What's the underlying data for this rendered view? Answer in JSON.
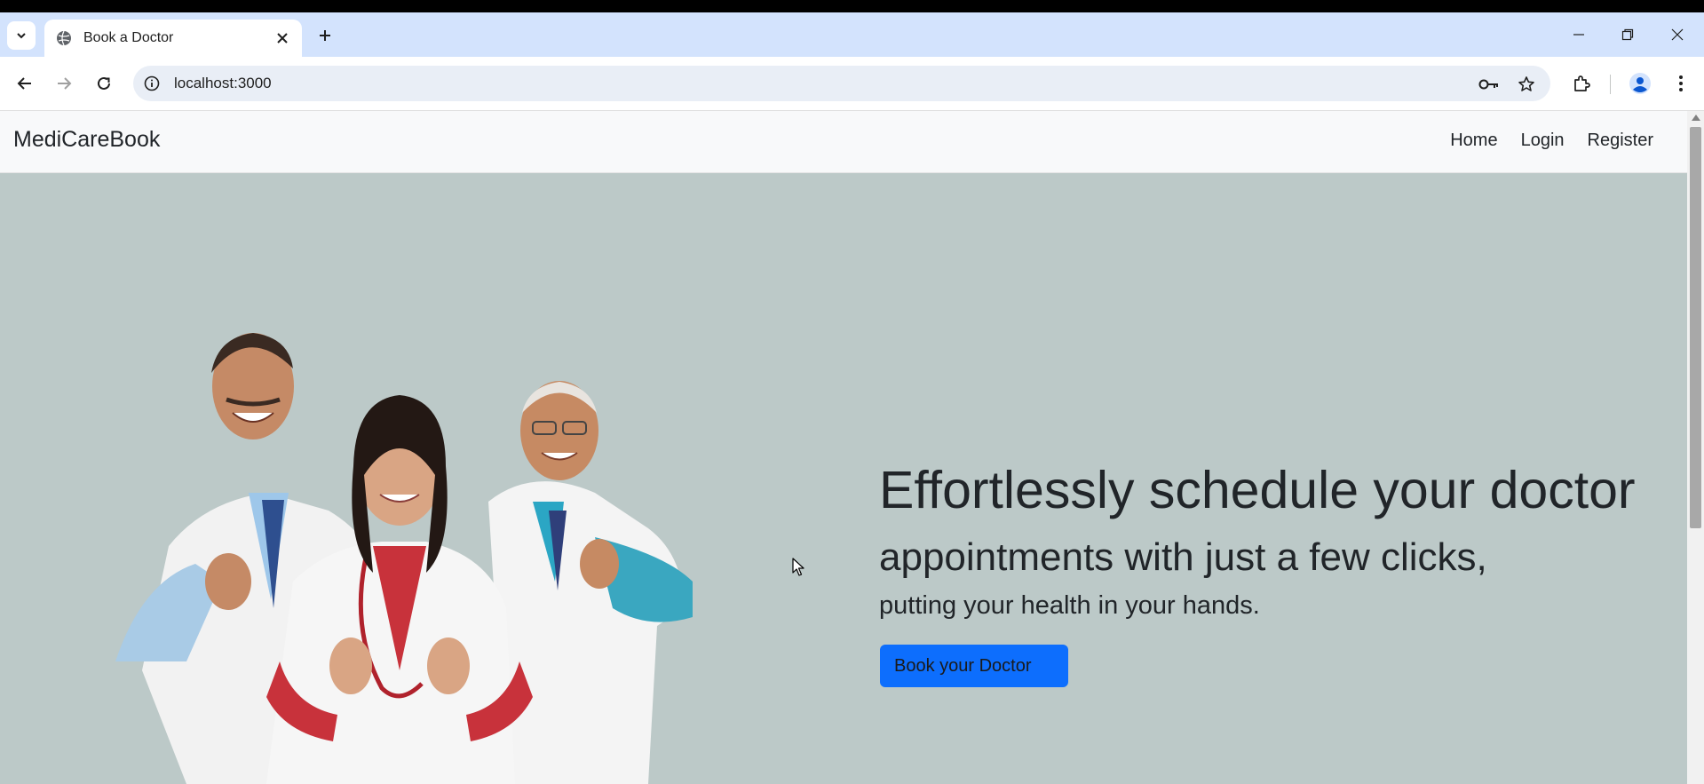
{
  "browser": {
    "tab_title": "Book a Doctor",
    "url": "localhost:3000"
  },
  "navbar": {
    "brand": "MediCareBook",
    "links": [
      "Home",
      "Login",
      "Register"
    ]
  },
  "hero": {
    "headline_1": "Effortlessly schedule your doctor",
    "headline_2": "appointments with just a few clicks,",
    "headline_3": "putting your health in your hands.",
    "cta_label": "Book your Doctor",
    "image_icon": "three-doctors-thumbs-up-photo"
  },
  "colors": {
    "page_bg": "#bcc9c8",
    "navbar_bg": "#f8f9fa",
    "cta_bg": "#0d6efd",
    "tabstrip_bg": "#d3e3fd"
  }
}
